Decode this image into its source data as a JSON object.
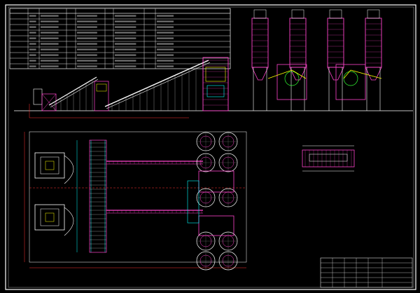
{
  "colors": {
    "background": "#000000",
    "frame": "#ffffff",
    "structure": "#ff44cc",
    "conveyor": "#ffffff",
    "dimension": "#ff3333",
    "steel": "#00ffff",
    "pipe": "#ffff00",
    "grid": "#dddddd",
    "green": "#33ff33"
  },
  "layers": [
    "spec-table",
    "elevation-view",
    "plan-view",
    "detail-view",
    "notes",
    "title-block"
  ],
  "icons": [
    "silo-icon",
    "mixer-icon",
    "conveyor-icon",
    "hopper-icon"
  ]
}
